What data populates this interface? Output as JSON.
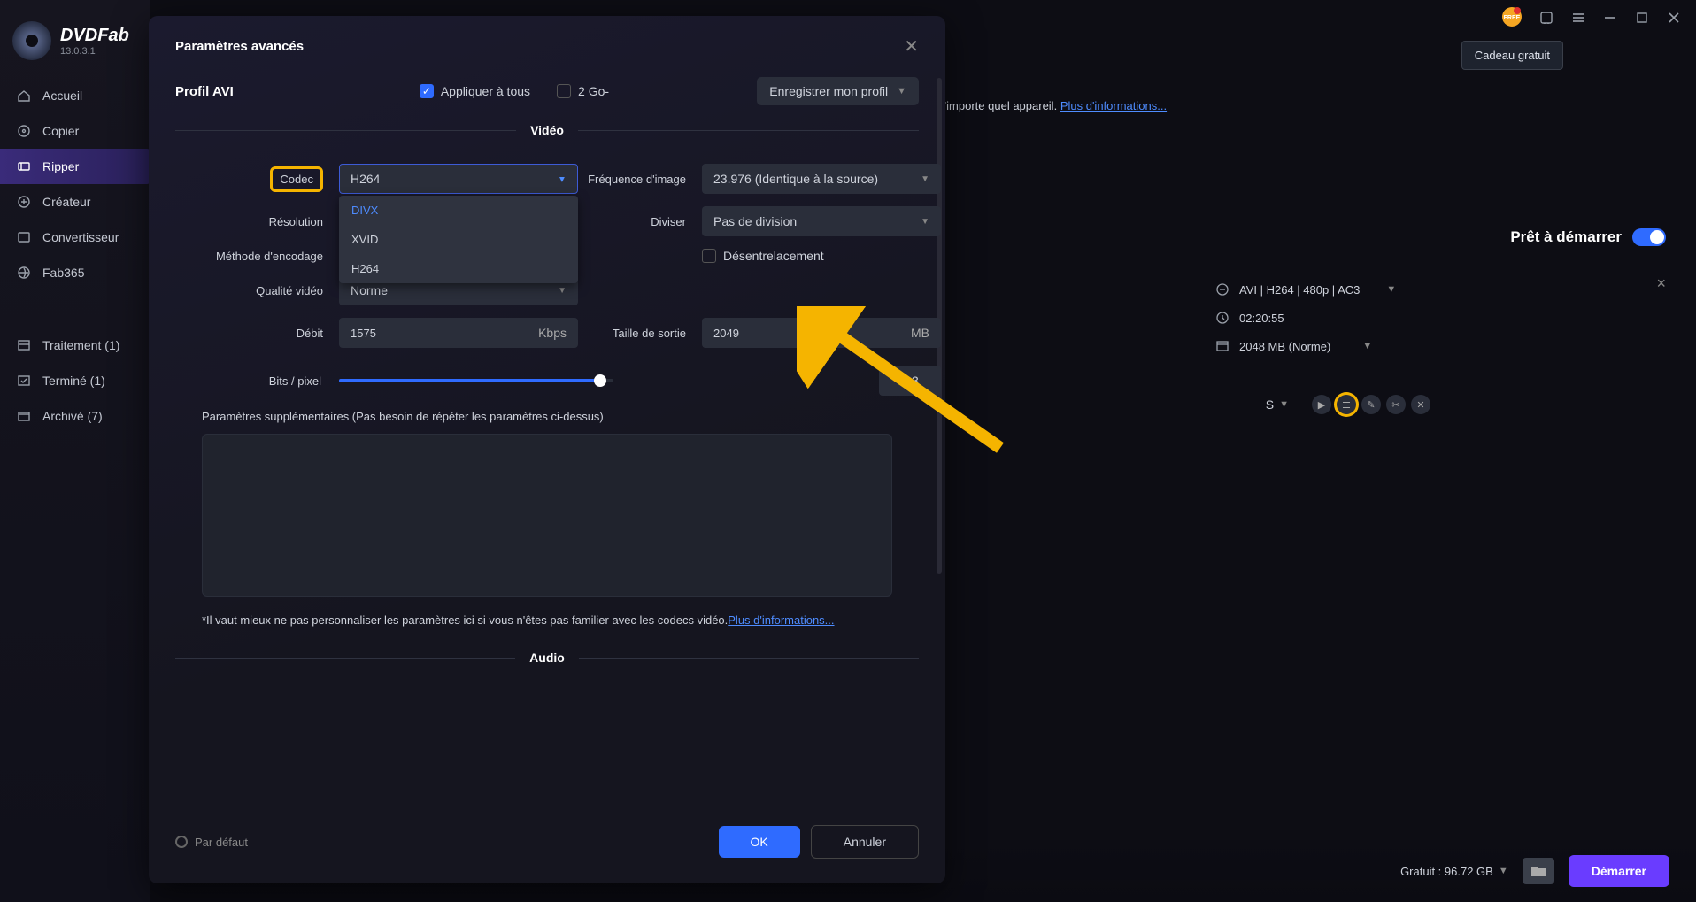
{
  "app": {
    "name": "DVDFab",
    "version": "13.0.3.1"
  },
  "titlebar": {
    "gift_tooltip": "Cadeau gratuit"
  },
  "sidebar": {
    "items": [
      {
        "icon": "home-icon",
        "label": "Accueil"
      },
      {
        "icon": "copy-icon",
        "label": "Copier"
      },
      {
        "icon": "ripper-icon",
        "label": "Ripper",
        "active": true
      },
      {
        "icon": "creator-icon",
        "label": "Créateur"
      },
      {
        "icon": "convert-icon",
        "label": "Convertisseur"
      },
      {
        "icon": "fab365-icon",
        "label": "Fab365"
      }
    ],
    "jobs": [
      {
        "label": "Traitement (1)"
      },
      {
        "label": "Terminé (1)"
      },
      {
        "label": "Archivé (7)"
      }
    ]
  },
  "background": {
    "desc_suffix": "encore, pour les lire sur n'importe quel appareil.",
    "more_info": "Plus d'informations..."
  },
  "task": {
    "ready": "Prêt à démarrer",
    "format_line": "AVI | H264 | 480p | AC3",
    "duration": "02:20:55",
    "size_line": "2048 MB (Norme)",
    "s_dropdown": "S",
    "close": "×"
  },
  "bottom": {
    "disk": "Gratuit : 96.72 GB",
    "start": "Démarrer"
  },
  "modal": {
    "title": "Paramètres avancés",
    "profile_label": "Profil AVI",
    "apply_all": "Appliquer à tous",
    "two_go": "2 Go-",
    "save_profile": "Enregistrer mon profil",
    "video_section": "Vidéo",
    "audio_section": "Audio",
    "rows": {
      "codec": "Codec",
      "codec_value": "H264",
      "codec_options": [
        "DIVX",
        "XVID",
        "H264"
      ],
      "framerate": "Fréquence d'image",
      "framerate_value": "23.976 (Identique à la source)",
      "resolution": "Résolution",
      "split": "Diviser",
      "split_value": "Pas de division",
      "encoding": "Méthode d'encodage",
      "deinterlace": "Désentrelacement",
      "quality": "Qualité vidéo",
      "quality_value": "Norme",
      "bitrate": "Débit",
      "bitrate_value": "1575",
      "bitrate_unit": "Kbps",
      "outsize": "Taille de sortie",
      "outsize_value": "2049",
      "outsize_unit": "MB",
      "bpp": "Bits / pixel",
      "bpp_value": "0.3",
      "extra_label": "Paramètres supplémentaires (Pas besoin de répéter les paramètres ci-dessus)",
      "warning_prefix": "*Il vaut mieux ne pas personnaliser les paramètres ici si vous n'êtes pas familier avec les codecs vidéo.",
      "warning_link": "Plus d'informations..."
    },
    "footer": {
      "default": "Par défaut",
      "ok": "OK",
      "cancel": "Annuler"
    }
  }
}
